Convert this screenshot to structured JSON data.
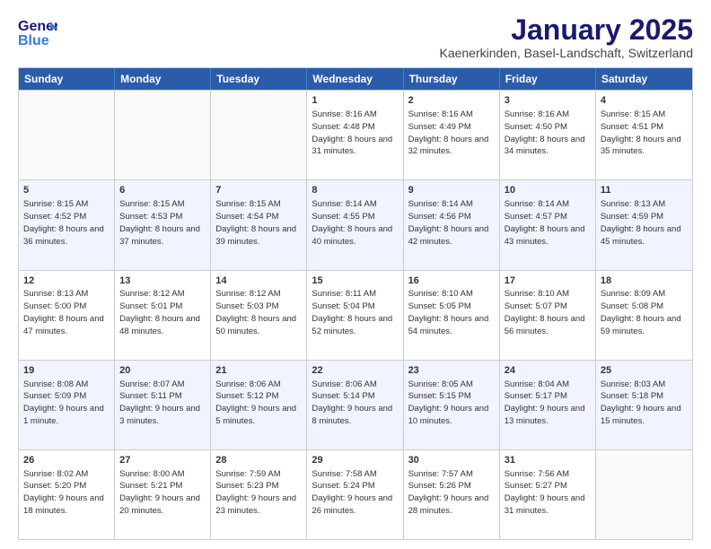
{
  "logo": {
    "line1": "General",
    "line2": "Blue"
  },
  "title": "January 2025",
  "subtitle": "Kaenerkinden, Basel-Landschaft, Switzerland",
  "days": [
    "Sunday",
    "Monday",
    "Tuesday",
    "Wednesday",
    "Thursday",
    "Friday",
    "Saturday"
  ],
  "rows": [
    [
      {
        "day": "",
        "text": ""
      },
      {
        "day": "",
        "text": ""
      },
      {
        "day": "",
        "text": ""
      },
      {
        "day": "1",
        "text": "Sunrise: 8:16 AM\nSunset: 4:48 PM\nDaylight: 8 hours and 31 minutes."
      },
      {
        "day": "2",
        "text": "Sunrise: 8:16 AM\nSunset: 4:49 PM\nDaylight: 8 hours and 32 minutes."
      },
      {
        "day": "3",
        "text": "Sunrise: 8:16 AM\nSunset: 4:50 PM\nDaylight: 8 hours and 34 minutes."
      },
      {
        "day": "4",
        "text": "Sunrise: 8:15 AM\nSunset: 4:51 PM\nDaylight: 8 hours and 35 minutes."
      }
    ],
    [
      {
        "day": "5",
        "text": "Sunrise: 8:15 AM\nSunset: 4:52 PM\nDaylight: 8 hours and 36 minutes."
      },
      {
        "day": "6",
        "text": "Sunrise: 8:15 AM\nSunset: 4:53 PM\nDaylight: 8 hours and 37 minutes."
      },
      {
        "day": "7",
        "text": "Sunrise: 8:15 AM\nSunset: 4:54 PM\nDaylight: 8 hours and 39 minutes."
      },
      {
        "day": "8",
        "text": "Sunrise: 8:14 AM\nSunset: 4:55 PM\nDaylight: 8 hours and 40 minutes."
      },
      {
        "day": "9",
        "text": "Sunrise: 8:14 AM\nSunset: 4:56 PM\nDaylight: 8 hours and 42 minutes."
      },
      {
        "day": "10",
        "text": "Sunrise: 8:14 AM\nSunset: 4:57 PM\nDaylight: 8 hours and 43 minutes."
      },
      {
        "day": "11",
        "text": "Sunrise: 8:13 AM\nSunset: 4:59 PM\nDaylight: 8 hours and 45 minutes."
      }
    ],
    [
      {
        "day": "12",
        "text": "Sunrise: 8:13 AM\nSunset: 5:00 PM\nDaylight: 8 hours and 47 minutes."
      },
      {
        "day": "13",
        "text": "Sunrise: 8:12 AM\nSunset: 5:01 PM\nDaylight: 8 hours and 48 minutes."
      },
      {
        "day": "14",
        "text": "Sunrise: 8:12 AM\nSunset: 5:03 PM\nDaylight: 8 hours and 50 minutes."
      },
      {
        "day": "15",
        "text": "Sunrise: 8:11 AM\nSunset: 5:04 PM\nDaylight: 8 hours and 52 minutes."
      },
      {
        "day": "16",
        "text": "Sunrise: 8:10 AM\nSunset: 5:05 PM\nDaylight: 8 hours and 54 minutes."
      },
      {
        "day": "17",
        "text": "Sunrise: 8:10 AM\nSunset: 5:07 PM\nDaylight: 8 hours and 56 minutes."
      },
      {
        "day": "18",
        "text": "Sunrise: 8:09 AM\nSunset: 5:08 PM\nDaylight: 8 hours and 59 minutes."
      }
    ],
    [
      {
        "day": "19",
        "text": "Sunrise: 8:08 AM\nSunset: 5:09 PM\nDaylight: 9 hours and 1 minute."
      },
      {
        "day": "20",
        "text": "Sunrise: 8:07 AM\nSunset: 5:11 PM\nDaylight: 9 hours and 3 minutes."
      },
      {
        "day": "21",
        "text": "Sunrise: 8:06 AM\nSunset: 5:12 PM\nDaylight: 9 hours and 5 minutes."
      },
      {
        "day": "22",
        "text": "Sunrise: 8:06 AM\nSunset: 5:14 PM\nDaylight: 9 hours and 8 minutes."
      },
      {
        "day": "23",
        "text": "Sunrise: 8:05 AM\nSunset: 5:15 PM\nDaylight: 9 hours and 10 minutes."
      },
      {
        "day": "24",
        "text": "Sunrise: 8:04 AM\nSunset: 5:17 PM\nDaylight: 9 hours and 13 minutes."
      },
      {
        "day": "25",
        "text": "Sunrise: 8:03 AM\nSunset: 5:18 PM\nDaylight: 9 hours and 15 minutes."
      }
    ],
    [
      {
        "day": "26",
        "text": "Sunrise: 8:02 AM\nSunset: 5:20 PM\nDaylight: 9 hours and 18 minutes."
      },
      {
        "day": "27",
        "text": "Sunrise: 8:00 AM\nSunset: 5:21 PM\nDaylight: 9 hours and 20 minutes."
      },
      {
        "day": "28",
        "text": "Sunrise: 7:59 AM\nSunset: 5:23 PM\nDaylight: 9 hours and 23 minutes."
      },
      {
        "day": "29",
        "text": "Sunrise: 7:58 AM\nSunset: 5:24 PM\nDaylight: 9 hours and 26 minutes."
      },
      {
        "day": "30",
        "text": "Sunrise: 7:57 AM\nSunset: 5:26 PM\nDaylight: 9 hours and 28 minutes."
      },
      {
        "day": "31",
        "text": "Sunrise: 7:56 AM\nSunset: 5:27 PM\nDaylight: 9 hours and 31 minutes."
      },
      {
        "day": "",
        "text": ""
      }
    ]
  ]
}
